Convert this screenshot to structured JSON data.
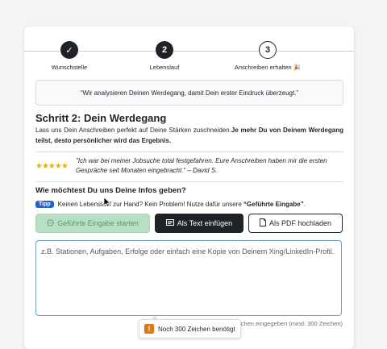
{
  "stepper": {
    "steps": [
      {
        "label": "Wunschstelle",
        "marker": "✓",
        "state": "done"
      },
      {
        "label": "Lebenslauf",
        "marker": "2",
        "state": "active"
      },
      {
        "label": "Anschreiben erhalten 🎉",
        "marker": "3",
        "state": "todo"
      }
    ]
  },
  "quote": "“Wir analysieren Deinen Werdegang, damit Dein erster Eindruck überzeugt.”",
  "title": "Schritt 2: Dein Werdegang",
  "intro": {
    "normal": "Lass uns Dein Anschreiben perfekt auf Deine Stärken zuschneiden.",
    "bold": "Je mehr Du von Deinem Werdegang teilst, desto persönlicher wird das Ergebnis."
  },
  "testimonial": {
    "stars": "★★★★★",
    "text": "\"Ich war bei meiner Jobsuche total festgefahren. Eure Anschreiben haben mir die ersten Gespräche seit Monaten eingebracht.\" – David S."
  },
  "question": "Wie möchtest Du uns Deine Infos geben?",
  "tip": {
    "badge": "Tipp",
    "text": "Keinen Lebenslauf zur Hand? Kein Problem! Nutze dafür unsere ",
    "bold": "“Geführte Eingabe”",
    "suffix": "."
  },
  "buttons": {
    "guided": "Geführte Eingabe starten",
    "paste": "Als Text einfügen",
    "pdf": "Als PDF hochladen"
  },
  "textarea": {
    "placeholder": "z.B. Stationen, Aufgaben, Erfolge oder einfach eine Kopie von Deinem Xing/LinkedIn-Profil."
  },
  "counter": "0 Zeichen eingegeben (mind. 300 Zeichen)",
  "tooltip": {
    "icon": "!",
    "text": "Noch 300 Zeichen benötigt"
  },
  "colors": {
    "dark": "#1f2328",
    "guided_bg": "#b8dfc6",
    "guided_text": "#4f9b6d",
    "tip_badge": "#2563c9",
    "star": "#e0b500",
    "focus_border": "#6f9bd6",
    "warning": "#e07b12"
  }
}
